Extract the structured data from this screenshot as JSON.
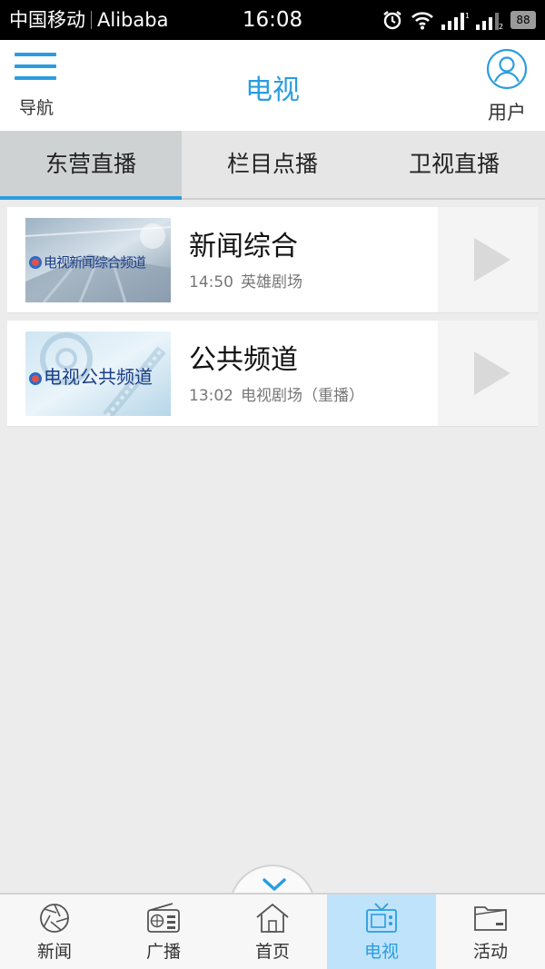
{
  "status_bar": {
    "carrier": "中国移动",
    "network_name": "Alibaba",
    "time": "16:08",
    "battery": "88",
    "icons": [
      "alarm-icon",
      "wifi-icon",
      "signal-icon",
      "signal-2-icon",
      "battery-icon"
    ]
  },
  "header": {
    "nav_label": "导航",
    "title": "电视",
    "user_label": "用户",
    "accent_color": "#2a9de0"
  },
  "tabs": [
    {
      "label": "东营直播",
      "active": true
    },
    {
      "label": "栏目点播",
      "active": false
    },
    {
      "label": "卫视直播",
      "active": false
    }
  ],
  "channels": [
    {
      "thumb_text": "电视新闻综合频道",
      "title": "新闻综合",
      "time": "14:50",
      "program": "英雄剧场"
    },
    {
      "thumb_text": "电视公共频道",
      "title": "公共频道",
      "time": "13:02",
      "program": "电视剧场（重播）"
    }
  ],
  "bottom_nav": [
    {
      "label": "新闻",
      "icon": "aperture-icon",
      "active": false
    },
    {
      "label": "广播",
      "icon": "radio-icon",
      "active": false
    },
    {
      "label": "首页",
      "icon": "home-icon",
      "active": false
    },
    {
      "label": "电视",
      "icon": "tv-icon",
      "active": true
    },
    {
      "label": "活动",
      "icon": "folder-icon",
      "active": false
    }
  ]
}
